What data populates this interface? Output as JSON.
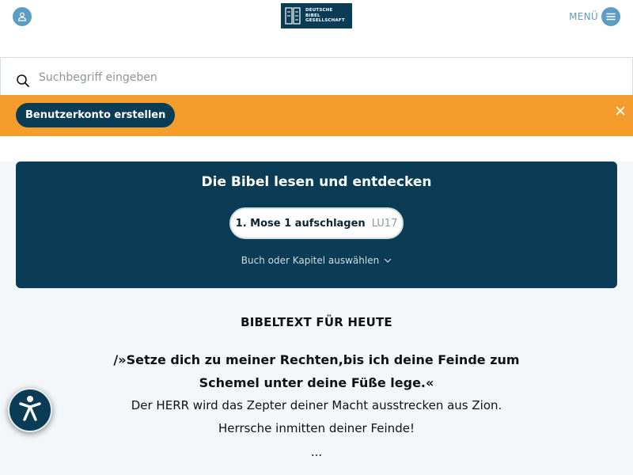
{
  "header": {
    "logo_text": "DEUTSCHE\nBIBEL\nGESELLSCHAFT",
    "menu_label": "MENÜ"
  },
  "search": {
    "placeholder": "Suchbegriff eingeben"
  },
  "banner": {
    "button_label": "Benutzerkonto erstellen"
  },
  "bible_card": {
    "title": "Die Bibel lesen und entdecken",
    "open_button_label": "1. Mose 1 aufschlagen",
    "open_button_version": "LU17",
    "select_book_label": "Buch oder Kapitel auswählen"
  },
  "daily_verse": {
    "title": "BIBELTEXT FÜR HEUTE",
    "bold_line_1": "/»Setze dich zu meiner Rechten,bis ich deine Feinde zum",
    "bold_line_2": "Schemel unter deine Füße lege.«",
    "line_3": "Der HERR wird das Zepter deiner Macht ausstrecken aus Zion.",
    "line_4": "Herrsche inmitten deiner Feinde!",
    "ellipsis": "..."
  },
  "colors": {
    "brand_dark": "#0b3c55",
    "accent_blue": "#5d9dc4",
    "banner_orange": "#f49d2c"
  },
  "icons": {
    "user": "user-icon",
    "menu": "hamburger-icon",
    "search": "search-icon",
    "close": "close-icon",
    "chevron": "chevron-down-icon",
    "accessibility": "accessibility-icon"
  }
}
